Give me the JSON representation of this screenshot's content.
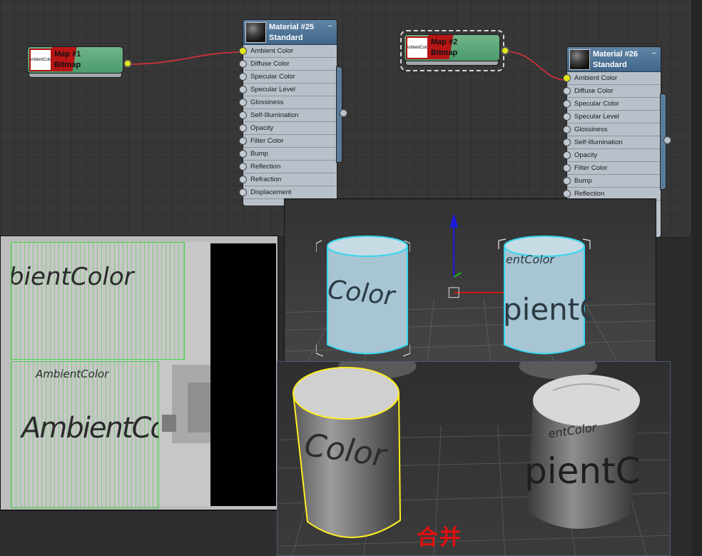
{
  "slate": {
    "map_nodes": [
      {
        "title": "Map #1",
        "type": "Bitmap",
        "thumb_text": "AmbientColor"
      },
      {
        "title": "Map #2",
        "type": "Bitmap",
        "thumb_text": "AmbientColor"
      }
    ],
    "materials": [
      {
        "name": "Material #25",
        "type": "Standard",
        "collapse_glyph": "−",
        "slots": [
          "Ambient Color",
          "Diffuse Color",
          "Specular Color",
          "Specular Level",
          "Glossiness",
          "Self-Illumination",
          "Opacity",
          "Filter Color",
          "Bump",
          "Reflection",
          "Refraction",
          "Displacement"
        ],
        "connected_slot": "Ambient Color"
      },
      {
        "name": "Material #26",
        "type": "Standard",
        "collapse_glyph": "−",
        "slots": [
          "Ambient Color",
          "Diffuse Color",
          "Specular Color",
          "Specular Level",
          "Glossiness",
          "Self-Illumination",
          "Opacity",
          "Filter Color",
          "Bump",
          "Reflection"
        ],
        "connected_slot": "Ambient Color"
      }
    ],
    "wire_color": "#e0303a",
    "node_header_color": "#3f6688",
    "map_node_color": "#5aa677"
  },
  "uv_panel": {
    "texts": [
      "bientColor",
      "AmbientColor",
      "AmbientColor"
    ],
    "grid_color": "#48d048"
  },
  "viewport_top": {
    "cylinder_texts": [
      "Color",
      "entColor",
      "pientC"
    ],
    "selection_color": "#38d6ee",
    "gizmo_icons": [
      "z-axis-arrow-icon",
      "x-axis-arrow-icon",
      "y-axis-icon"
    ]
  },
  "viewport_bottom": {
    "cylinder_texts": [
      "Color",
      "entColor",
      "pientC"
    ],
    "selection_color": "#ffee22",
    "merge_label": "合并",
    "merge_label_color": "#e01010"
  }
}
